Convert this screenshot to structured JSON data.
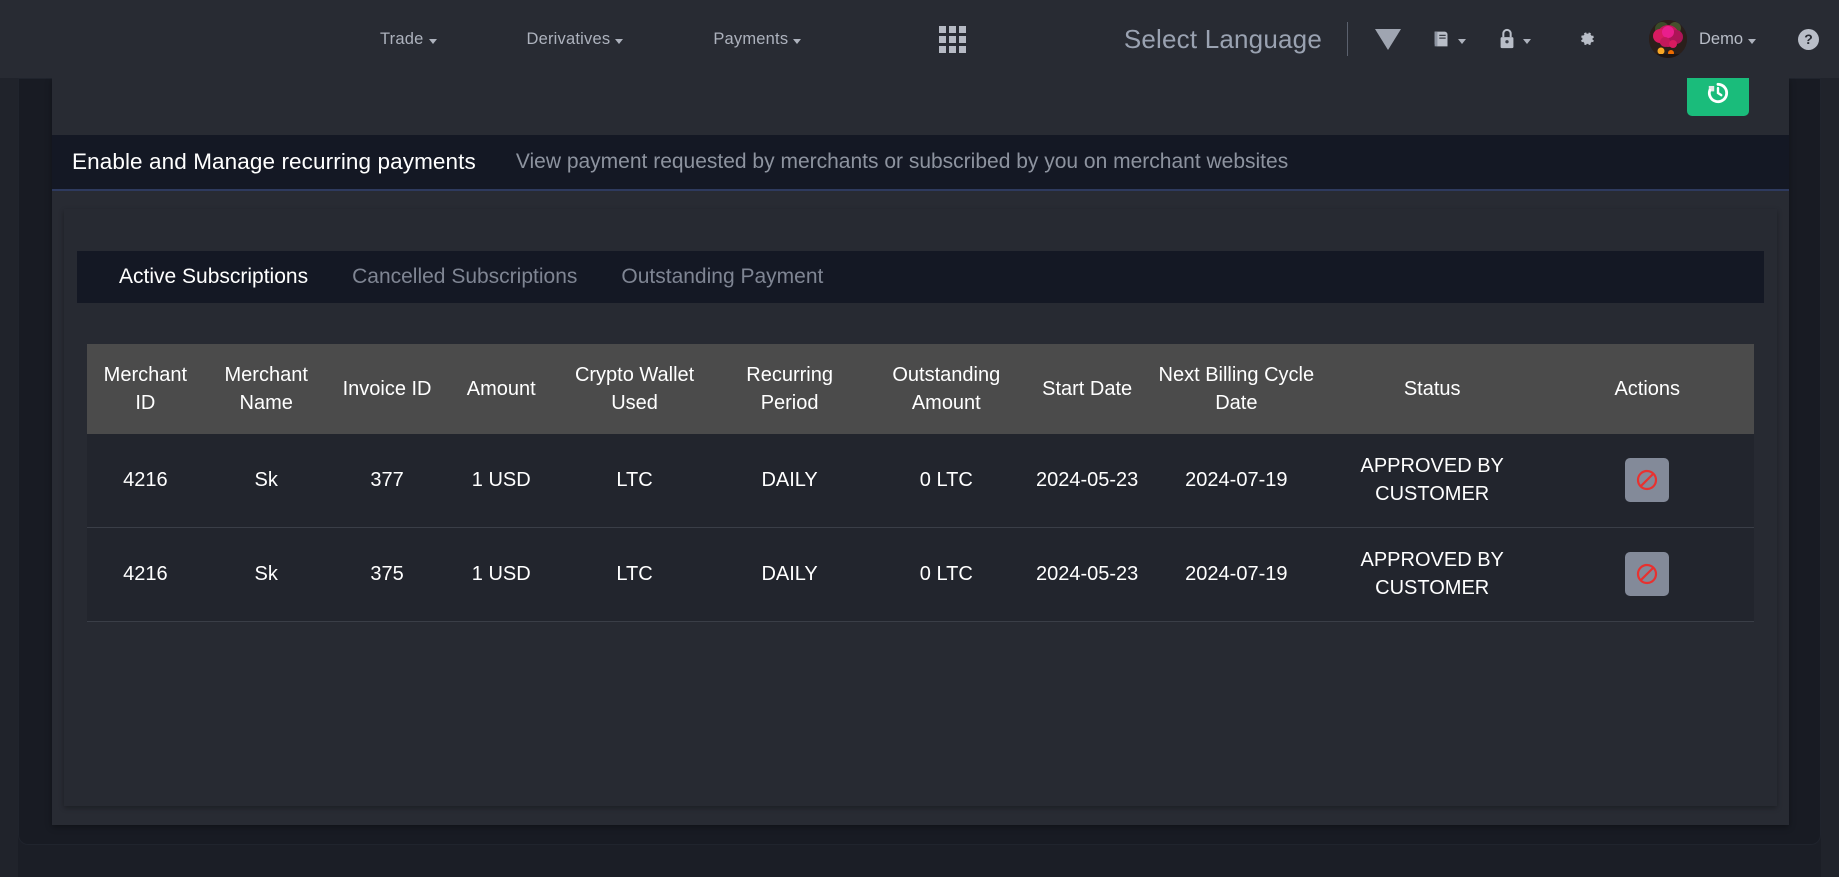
{
  "navbar": {
    "menu": [
      {
        "label": "Trade",
        "has_caret": true
      },
      {
        "label": "Derivatives",
        "has_caret": true
      },
      {
        "label": "Payments",
        "has_caret": true
      }
    ],
    "apps_icon": "grid-apps-icon",
    "language_label": "Select Language",
    "icons": [
      {
        "name": "triangle-down-icon",
        "has_caret": false
      },
      {
        "name": "book-icon",
        "has_caret": true
      },
      {
        "name": "lock-icon",
        "has_caret": true
      },
      {
        "name": "gear-icon",
        "has_caret": false
      }
    ],
    "user": {
      "name": "Demo",
      "avatar": "user-avatar-flowers"
    },
    "help_label": "?"
  },
  "toolbar": {
    "history_button": {
      "name": "history-icon",
      "title": "History"
    }
  },
  "section": {
    "title": "Enable and Manage recurring payments",
    "subtitle": "View payment requested by merchants or subscribed by you on merchant websites"
  },
  "tabs": [
    {
      "label": "Active Subscriptions",
      "active": true
    },
    {
      "label": "Cancelled Subscriptions",
      "active": false
    },
    {
      "label": "Outstanding Payment",
      "active": false
    }
  ],
  "table": {
    "columns": [
      "Merchant ID",
      "Merchant Name",
      "Invoice ID",
      "Amount",
      "Crypto Wallet Used",
      "Recurring Period",
      "Outstanding Amount",
      "Start Date",
      "Next Billing Cycle Date",
      "Status",
      "Actions"
    ],
    "rows": [
      {
        "merchant_id": "4216",
        "merchant_name": "Sk",
        "invoice_id": "377",
        "amount": "1 USD",
        "crypto_wallet_used": "LTC",
        "recurring_period": "DAILY",
        "outstanding_amount": "0 LTC",
        "start_date": "2024-05-23",
        "next_billing_cycle_date": "2024-07-19",
        "status": "APPROVED BY CUSTOMER",
        "action": "cancel-subscription-button"
      },
      {
        "merchant_id": "4216",
        "merchant_name": "Sk",
        "invoice_id": "375",
        "amount": "1 USD",
        "crypto_wallet_used": "LTC",
        "recurring_period": "DAILY",
        "outstanding_amount": "0 LTC",
        "start_date": "2024-05-23",
        "next_billing_cycle_date": "2024-07-19",
        "status": "APPROVED BY CUSTOMER",
        "action": "cancel-subscription-button"
      }
    ]
  },
  "colors": {
    "navbar_bg": "#282b33",
    "page_bg": "#1b1e26",
    "card_bg": "#282b33",
    "header_strip_bg": "#141824",
    "header_accent": "#2e3a5e",
    "table_head_bg": "#4b4b4b",
    "row_bg": "#22252d",
    "accent_green": "#1abc7b",
    "ban_red": "#e8312f",
    "action_btn_bg": "#838a99"
  }
}
